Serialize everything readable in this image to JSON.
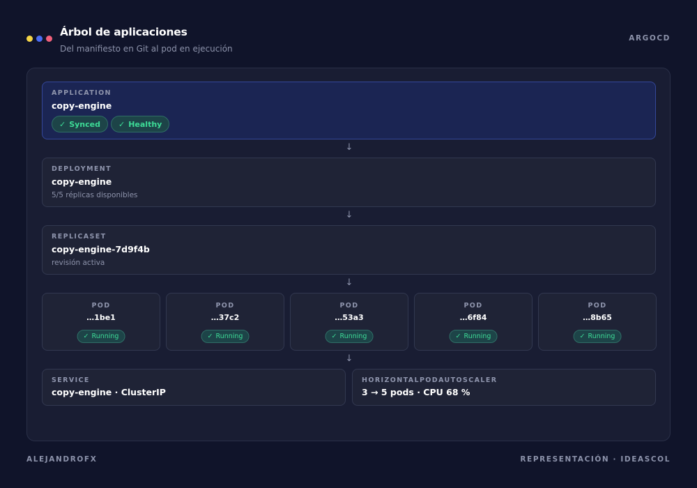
{
  "colors": {
    "background": "#10142a",
    "panel": "#191d33",
    "card": "#1f2336",
    "app_card": "#1b2553",
    "accent_green": "#3ddc97",
    "dot_yellow": "#f5d547",
    "dot_blue": "#4a6cf0",
    "dot_pink": "#f0607a"
  },
  "header": {
    "title": "Árbol de aplicaciones",
    "subtitle": "Del manifiesto en Git al pod en ejecución",
    "brand": "ARGOCD"
  },
  "application": {
    "kind": "APPLICATION",
    "name": "copy-engine",
    "badges": [
      {
        "icon": "check-icon",
        "glyph": "✓",
        "label": "Synced"
      },
      {
        "icon": "check-icon",
        "glyph": "✓",
        "label": "Healthy"
      }
    ]
  },
  "deployment": {
    "kind": "DEPLOYMENT",
    "name": "copy-engine",
    "note": "5/5 réplicas disponibles"
  },
  "replicaset": {
    "kind": "REPLICASET",
    "name": "copy-engine-7d9f4b",
    "note": "revisión activa"
  },
  "arrow_glyph": "↓",
  "pods": [
    {
      "kind": "POD",
      "name": "…1be1",
      "status_glyph": "✓",
      "status": "Running"
    },
    {
      "kind": "POD",
      "name": "…37c2",
      "status_glyph": "✓",
      "status": "Running"
    },
    {
      "kind": "POD",
      "name": "…53a3",
      "status_glyph": "✓",
      "status": "Running"
    },
    {
      "kind": "POD",
      "name": "…6f84",
      "status_glyph": "✓",
      "status": "Running"
    },
    {
      "kind": "POD",
      "name": "…8b65",
      "status_glyph": "✓",
      "status": "Running"
    }
  ],
  "service": {
    "kind": "SERVICE",
    "name": "copy-engine · ClusterIP"
  },
  "hpa": {
    "kind": "HORIZONTALPODAUTOSCALER",
    "name": "3 → 5 pods · CPU 68 %"
  },
  "footer": {
    "left": "ALEJANDROFX",
    "right": "REPRESENTACIÓN · IDEASCOL"
  }
}
